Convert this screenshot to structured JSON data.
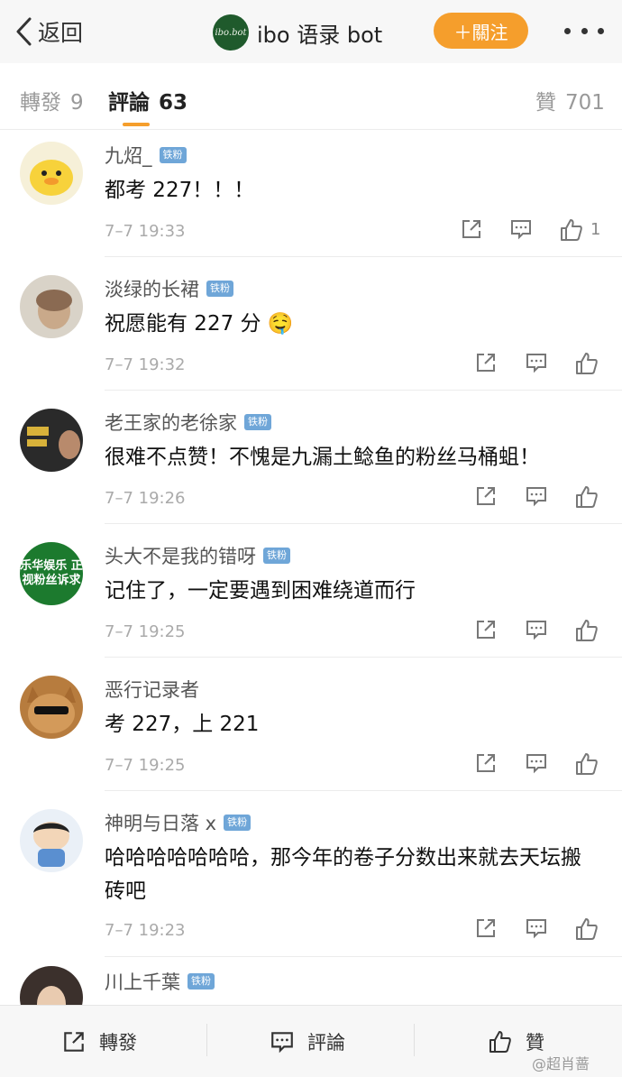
{
  "header": {
    "back_label": "返回",
    "logo_text": "ibo.bot",
    "account_name": "ibo 语录 bot",
    "follow_label": "＋關注",
    "more_icon": "more-dots-icon"
  },
  "tabs": [
    {
      "label": "轉發",
      "count": "9"
    },
    {
      "label": "評論",
      "count": "63"
    },
    {
      "label": "贊",
      "count": "701"
    }
  ],
  "comments": [
    {
      "user": "九炤_",
      "badge": "铁粉",
      "text": "都考 227！！！",
      "time": "7–7 19:33",
      "likes": "1"
    },
    {
      "user": "淡绿的长裙",
      "badge": "铁粉",
      "text": "祝愿能有 227 分 🤤",
      "time": "7–7 19:32",
      "likes": ""
    },
    {
      "user": "老王家的老徐家",
      "badge": "铁粉",
      "text": "很难不点赞！不愧是九漏土鲶鱼的粉丝马桶蛆！",
      "time": "7–7 19:26",
      "likes": ""
    },
    {
      "user": "头大不是我的错呀",
      "badge": "铁粉",
      "text": "记住了，一定要遇到困难绕道而行",
      "time": "7–7 19:25",
      "likes": "",
      "avatar_text": "乐华娱乐 正视粉丝诉求"
    },
    {
      "user": "恶行记录者",
      "badge": "",
      "text": "考 227，上 221",
      "time": "7–7 19:25",
      "likes": ""
    },
    {
      "user": "神明与日落 x",
      "badge": "铁粉",
      "text": "哈哈哈哈哈哈哈，那今年的卷子分数出来就去天坛搬砖吧",
      "time": "7–7 19:23",
      "likes": ""
    },
    {
      "user": "川上千葉",
      "badge": "铁粉",
      "text": "",
      "time": "",
      "likes": ""
    }
  ],
  "bottom": {
    "repost_label": "轉發",
    "comment_label": "評論",
    "like_label": "贊"
  },
  "watermark": "@超肖蔷",
  "colors": {
    "accent_orange": "#f59e2c",
    "badge_blue": "#6fa6d8",
    "logo_green": "#1f5a2c"
  }
}
